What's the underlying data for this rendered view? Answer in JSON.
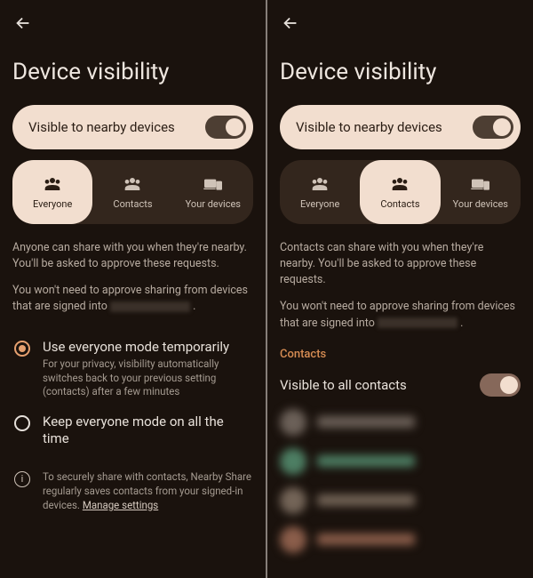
{
  "left": {
    "title": "Device visibility",
    "visiblePill": "Visible to nearby devices",
    "tabs": {
      "everyone": "Everyone",
      "contacts": "Contacts",
      "devices": "Your devices"
    },
    "desc1": "Anyone can share with you when they're nearby. You'll be asked to approve these requests.",
    "desc2_a": "You won't need to approve sharing from devices that are signed into",
    "desc2_b": ".",
    "radio1": {
      "title": "Use everyone mode temporarily",
      "sub": "For your privacy, visibility automatically switches back to your previous setting (contacts) after a few minutes"
    },
    "radio2": {
      "title": "Keep everyone mode on all the time"
    },
    "info": "To securely share with contacts, Nearby Share regularly saves contacts from your signed-in devices.",
    "infoLink": "Manage settings"
  },
  "right": {
    "title": "Device visibility",
    "visiblePill": "Visible to nearby devices",
    "tabs": {
      "everyone": "Everyone",
      "contacts": "Contacts",
      "devices": "Your devices"
    },
    "desc1": "Contacts can share with you when they're nearby. You'll be asked to approve these requests.",
    "desc2_a": "You won't need to approve sharing from devices that are signed into",
    "desc2_b": ".",
    "section": "Contacts",
    "allContacts": "Visible to all contacts",
    "contactColors": [
      "#6b6058",
      "#4d7e63",
      "#736457",
      "#8a5d4a"
    ]
  }
}
